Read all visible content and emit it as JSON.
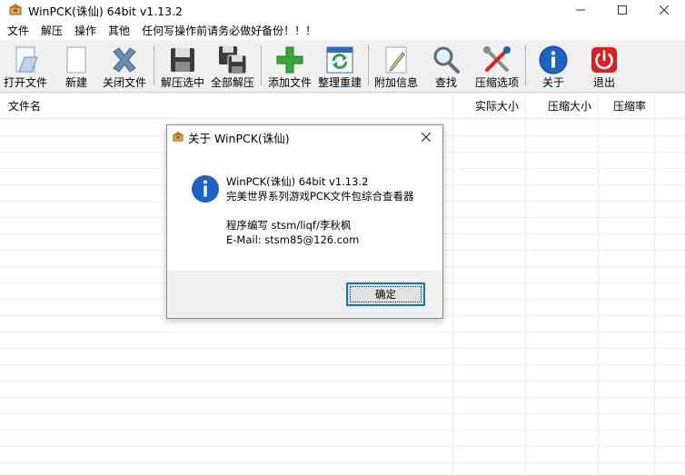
{
  "window": {
    "title": "WinPCK(诛仙) 64bit v1.13.2"
  },
  "menubar": {
    "items": [
      "文件",
      "解压",
      "操作",
      "其他",
      "任何写操作前请务必做好备份！！！"
    ]
  },
  "toolbar": {
    "buttons": [
      {
        "label": "打开文件",
        "icon": "open-file-icon"
      },
      {
        "label": "新建",
        "icon": "new-file-icon"
      },
      {
        "label": "关闭文件",
        "icon": "close-file-icon"
      },
      {
        "label": "解压选中",
        "icon": "extract-selected-icon"
      },
      {
        "label": "全部解压",
        "icon": "extract-all-icon"
      },
      {
        "label": "添加文件",
        "icon": "add-file-icon"
      },
      {
        "label": "整理重建",
        "icon": "rebuild-icon"
      },
      {
        "label": "附加信息",
        "icon": "attach-info-icon"
      },
      {
        "label": "查找",
        "icon": "search-icon"
      },
      {
        "label": "压缩选项",
        "icon": "compress-options-icon"
      },
      {
        "label": "关于",
        "icon": "about-icon"
      },
      {
        "label": "退出",
        "icon": "exit-icon"
      }
    ]
  },
  "list": {
    "columns": [
      "文件名",
      "实际大小",
      "压缩大小",
      "压缩率"
    ]
  },
  "dialog": {
    "title": "关于 WinPCK(诛仙)",
    "lines": [
      "WinPCK(诛仙) 64bit v1.13.2",
      "完美世界系列游戏PCK文件包综合查看器",
      "程序编写 stsm/liqf/李秋枫",
      "E-Mail: stsm85@126.com"
    ],
    "ok_label": "确定"
  },
  "colors": {
    "accent": "#0078d7",
    "add_green": "#3aa635",
    "info_blue": "#1c63c4",
    "exit_red": "#d9201c"
  }
}
